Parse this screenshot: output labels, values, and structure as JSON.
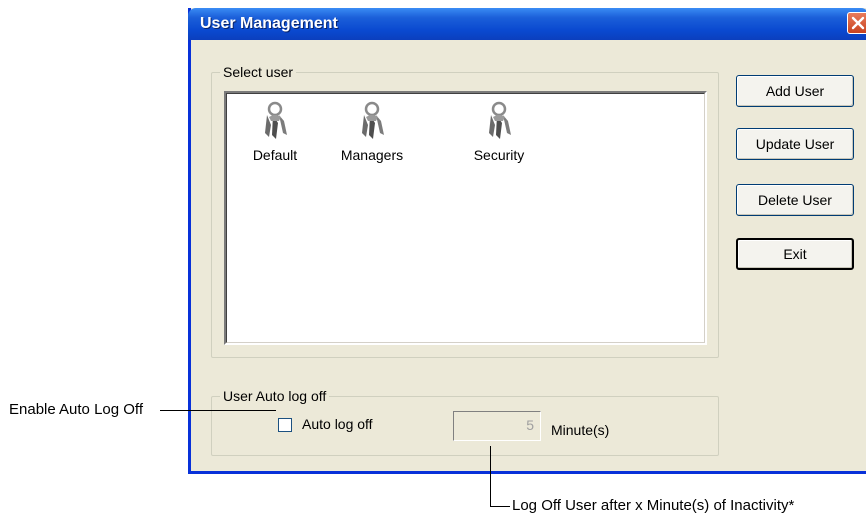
{
  "window": {
    "title": "User Management",
    "close_icon": "close-icon"
  },
  "select_user": {
    "legend": "Select user",
    "users": [
      {
        "label": "Default",
        "icon": "keys-icon"
      },
      {
        "label": "Managers",
        "icon": "keys-icon"
      },
      {
        "label": "Security",
        "icon": "keys-icon"
      }
    ]
  },
  "buttons": {
    "add_user": "Add User",
    "update_user": "Update User",
    "delete_user": "Delete User",
    "exit": "Exit"
  },
  "auto_log_off": {
    "legend": "User Auto log off",
    "checkbox_label": "Auto log off",
    "checked": false,
    "minutes_value": "5",
    "minutes_label": "Minute(s)"
  },
  "callouts": {
    "enable": "Enable Auto Log Off",
    "inactivity": "Log Off User after x Minute(s) of Inactivity*"
  },
  "colors": {
    "titlebar": "#0a49d0",
    "window_bg": "#ece9d8",
    "close_button": "#c8431f"
  }
}
